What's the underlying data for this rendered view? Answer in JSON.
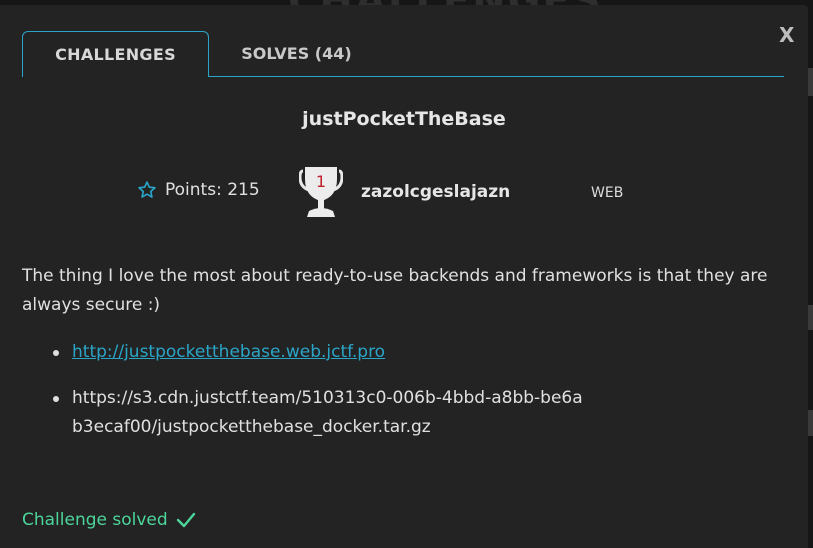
{
  "background": {
    "page_heading": "CHALLENGES"
  },
  "modal": {
    "close_label": "X",
    "tabs": [
      {
        "label": "CHALLENGES",
        "active": true
      },
      {
        "label": "SOLVES (44)",
        "active": false
      }
    ],
    "challenge": {
      "name": "justPocketTheBase",
      "points_label": "Points: 215",
      "first_blood_rank": "1",
      "first_blood_user": "zazolcgeslajazn",
      "category": "WEB",
      "description": "The thing I love the most about ready-to-use backends and frameworks is that they are always secure :)",
      "links": [
        "http://justpocketthebase.web.jctf.pro",
        "https://s3.cdn.justctf.team/510313c0-006b-4bbd-a8bb-be6ab3ecaf00/justpocketthebase_docker.tar.gz"
      ],
      "status": "Challenge solved"
    }
  },
  "colors": {
    "accent": "#2aa5c8",
    "success": "#4cd59a",
    "modal_bg": "#232323",
    "page_bg": "#161616"
  },
  "icons": [
    "star-icon",
    "trophy-icon",
    "checkmark-icon"
  ]
}
